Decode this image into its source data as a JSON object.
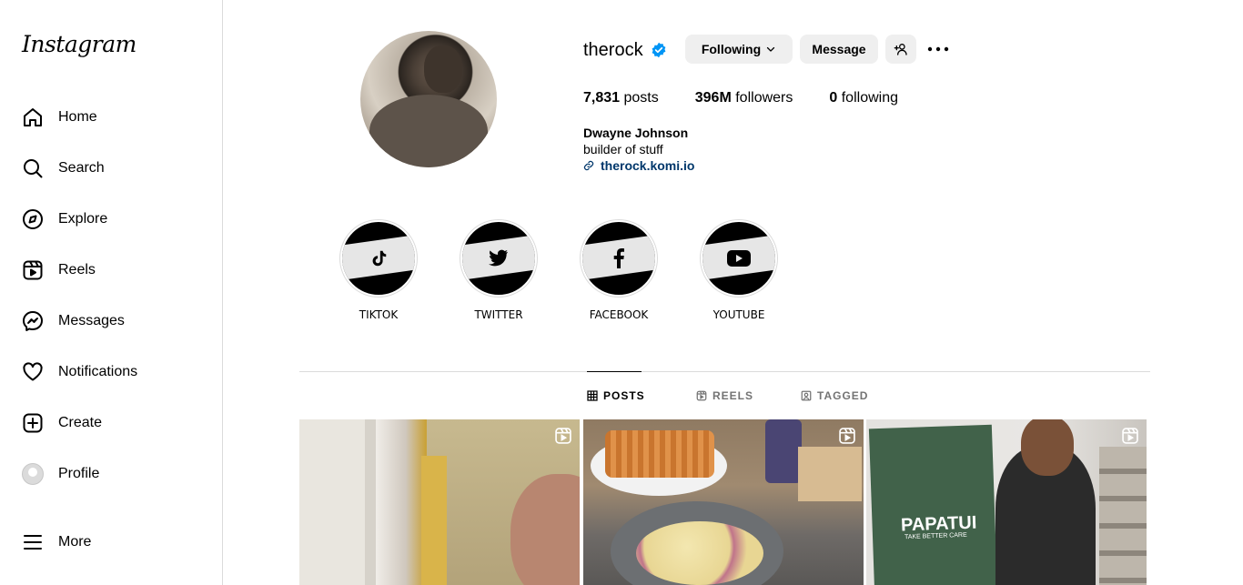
{
  "sidebar": {
    "logo": "Instagram",
    "items": [
      {
        "label": "Home",
        "icon": "home-icon"
      },
      {
        "label": "Search",
        "icon": "search-icon"
      },
      {
        "label": "Explore",
        "icon": "compass-icon"
      },
      {
        "label": "Reels",
        "icon": "reels-icon"
      },
      {
        "label": "Messages",
        "icon": "messenger-icon"
      },
      {
        "label": "Notifications",
        "icon": "heart-icon"
      },
      {
        "label": "Create",
        "icon": "plus-square-icon"
      },
      {
        "label": "Profile",
        "icon": "avatar"
      }
    ],
    "more": "More"
  },
  "profile": {
    "username": "therock",
    "following_button": "Following",
    "message_button": "Message",
    "stats": {
      "posts_count": "7,831",
      "posts_label": "posts",
      "followers_count": "396M",
      "followers_label": "followers",
      "following_count": "0",
      "following_label": "following"
    },
    "full_name": "Dwayne Johnson",
    "bio": "builder of stuff",
    "link": "therock.komi.io"
  },
  "highlights": [
    {
      "label": "TIKTOK",
      "icon": "tiktok-icon"
    },
    {
      "label": "TWITTER",
      "icon": "twitter-icon"
    },
    {
      "label": "FACEBOOK",
      "icon": "facebook-icon"
    },
    {
      "label": "YOUTUBE",
      "icon": "youtube-icon"
    }
  ],
  "tabs": [
    {
      "label": "POSTS",
      "active": true
    },
    {
      "label": "REELS",
      "active": false
    },
    {
      "label": "TAGGED",
      "active": false
    }
  ],
  "posts": [
    {
      "type": "reel"
    },
    {
      "type": "reel"
    },
    {
      "type": "reel",
      "brand": "PAPATUI",
      "tagline": "TAKE BETTER CARE"
    }
  ],
  "colors": {
    "verified": "#0095f6",
    "link": "#00376b",
    "button_bg": "#efefef",
    "border": "#dbdbdb",
    "muted": "#737373"
  }
}
